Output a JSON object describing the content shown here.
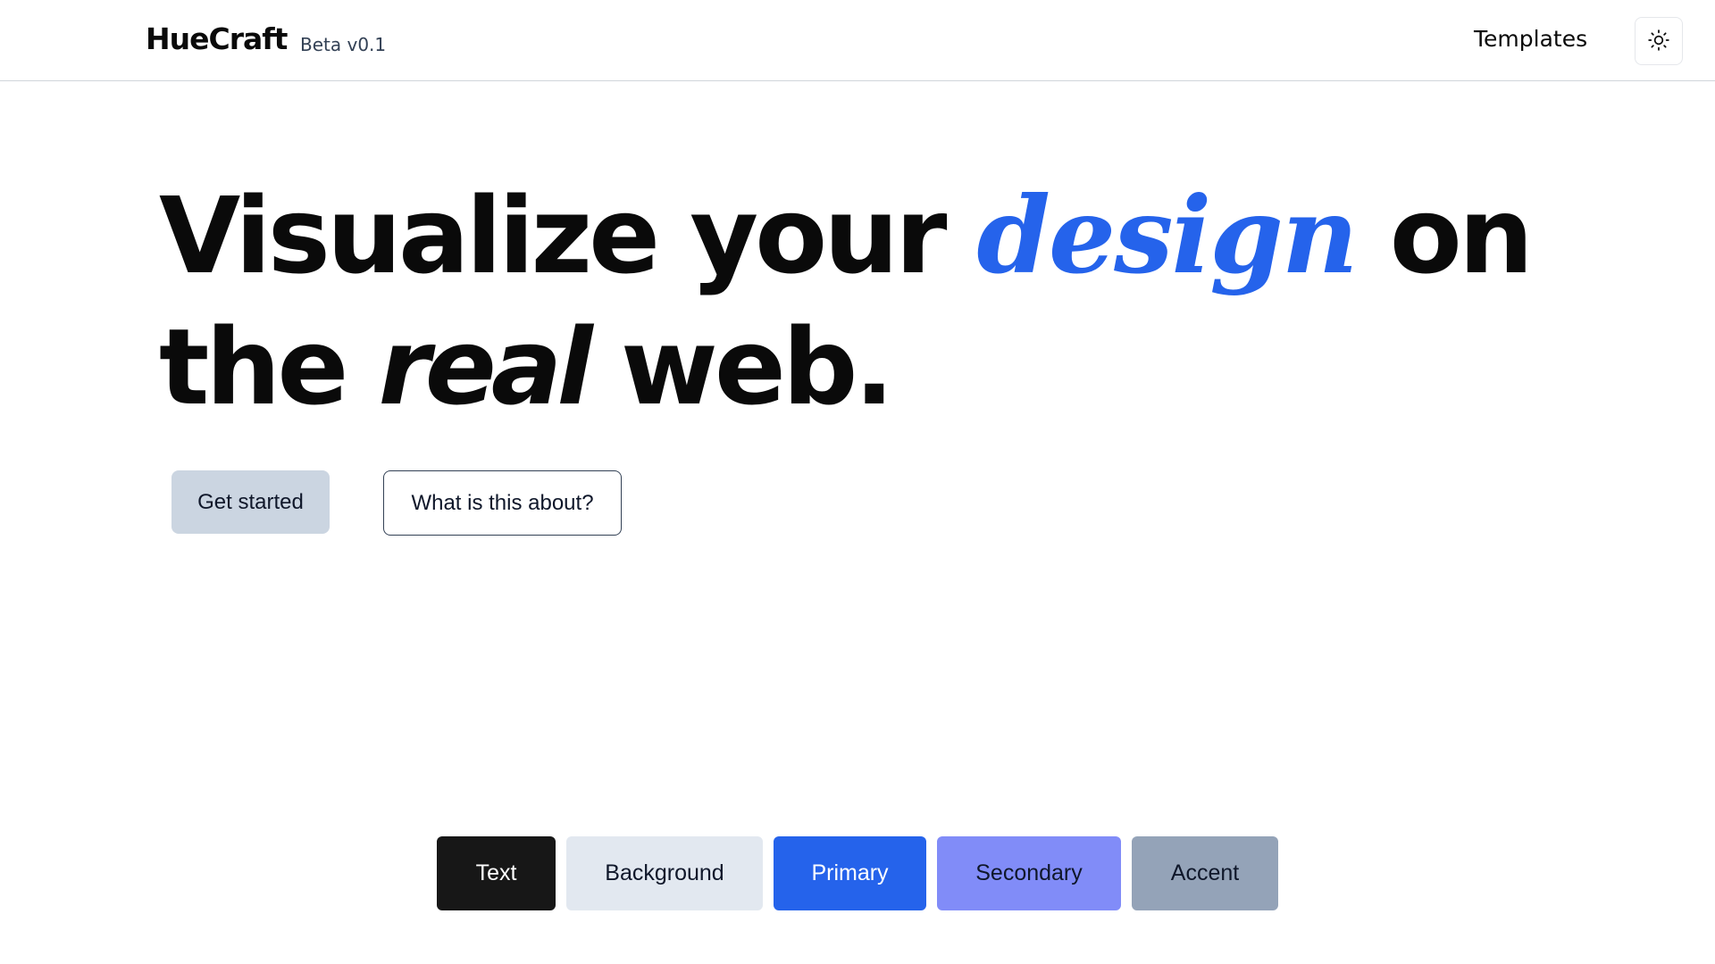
{
  "header": {
    "logo": "HueCraft",
    "badge": "Beta v0.1",
    "nav": {
      "templates": "Templates"
    },
    "theme_toggle_icon": "sun-icon"
  },
  "hero": {
    "line1": {
      "part1": "Visualize your ",
      "highlight": "design",
      "part2": " on"
    },
    "line2": {
      "part1": "the ",
      "italic": "real",
      "part2": " web."
    },
    "buttons": {
      "get_started": "Get started",
      "about": "What is this about?"
    }
  },
  "swatches": [
    {
      "label": "Text",
      "color": "#171717"
    },
    {
      "label": "Background",
      "color": "#e2e8f0"
    },
    {
      "label": "Primary",
      "color": "#2563eb"
    },
    {
      "label": "Secondary",
      "color": "#818cf8"
    },
    {
      "label": "Accent",
      "color": "#94a3b8"
    }
  ]
}
